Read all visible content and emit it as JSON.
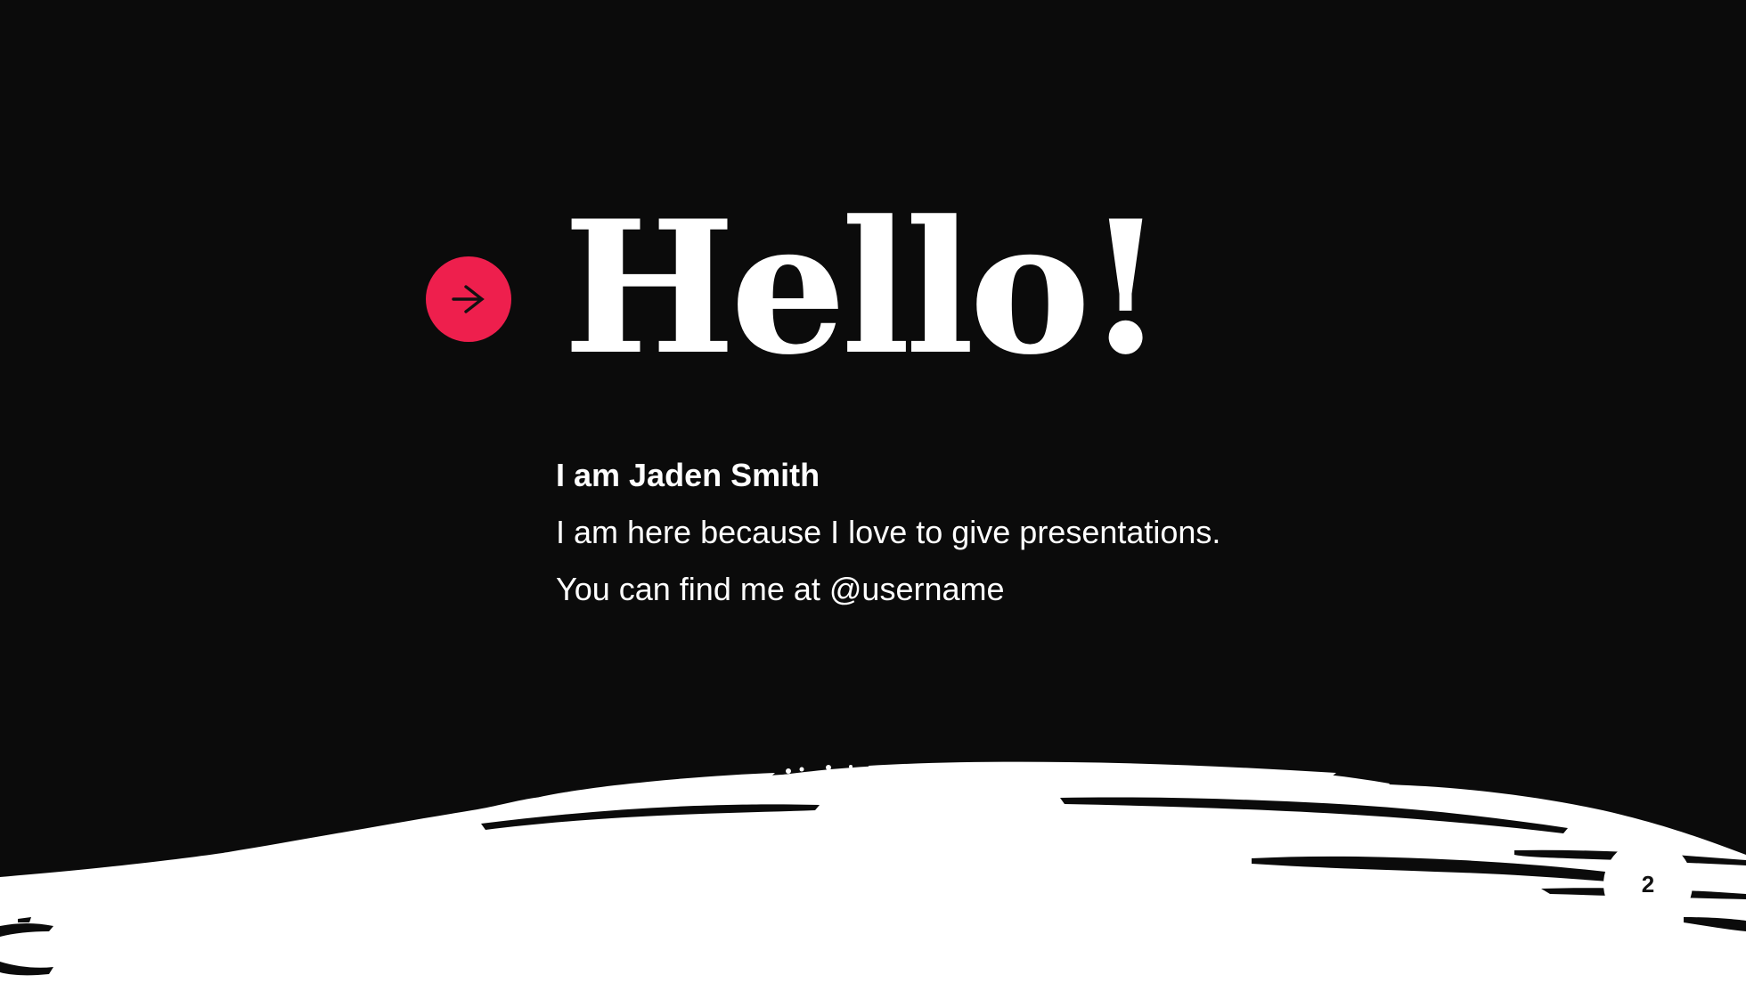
{
  "slide": {
    "title": "Hello!",
    "name_line": "I am Jaden Smith",
    "lines": [
      "I am here because I love to give presentations.",
      "You can find me at @username"
    ],
    "page_number": "2",
    "icon": "arrow-right-icon"
  },
  "colors": {
    "background": "#0b0b0b",
    "accent": "#ee1f4d",
    "text": "#ffffff",
    "brush": "#ffffff"
  }
}
